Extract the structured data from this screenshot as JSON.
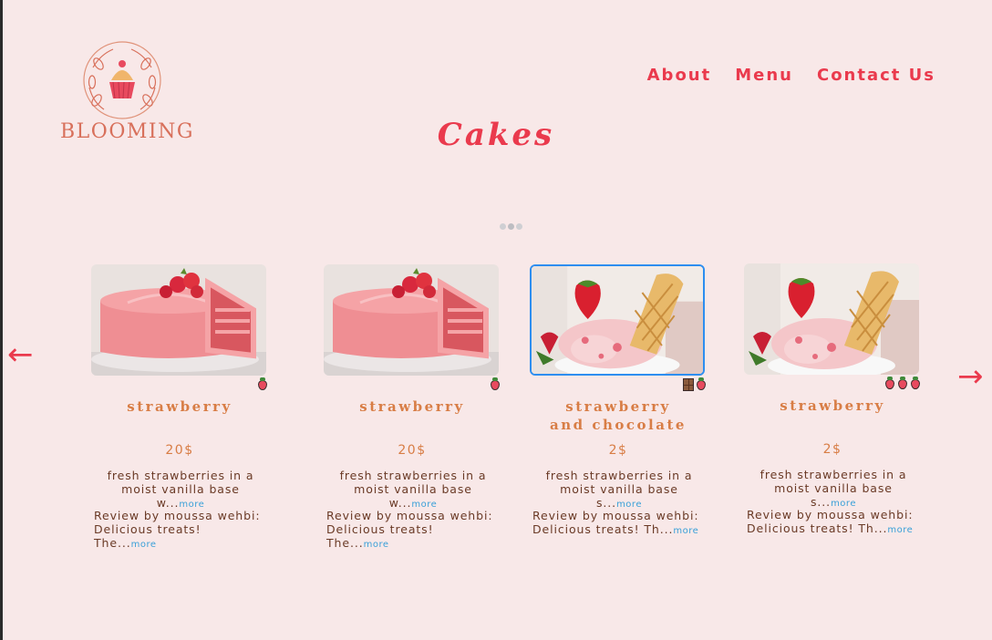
{
  "brand": {
    "name": "BLOOMING",
    "logo_icon": "cupcake-wreath-icon"
  },
  "nav": [
    {
      "label": "About"
    },
    {
      "label": "Menu"
    },
    {
      "label": "Contact Us"
    }
  ],
  "page": {
    "title": "Cakes"
  },
  "carousel": {
    "prev_icon": "arrow-left-icon",
    "next_icon": "arrow-right-icon",
    "prev_glyph": "←",
    "next_glyph": "→",
    "dots": 3,
    "active_dot": 1
  },
  "products": [
    {
      "name": "strawberry",
      "price": "20$",
      "desc_line1": "fresh strawberries in a",
      "desc_line2": "moist vanilla base w...",
      "review_line1": "Review by moussa wehbi:",
      "review_line2": "Delicious treats! The...",
      "more_label": "more",
      "image": "strawberry-cake",
      "badges": [
        "strawberry"
      ]
    },
    {
      "name": "strawberry",
      "price": "20$",
      "desc_line1": "fresh strawberries in a",
      "desc_line2": "moist vanilla base w...",
      "review_line1": "Review by moussa wehbi:",
      "review_line2": "Delicious treats! The...",
      "more_label": "more",
      "image": "strawberry-cake",
      "badges": [
        "strawberry"
      ]
    },
    {
      "name": "strawberry and chocolate",
      "name_line1": "strawberry",
      "name_line2": "and chocolate",
      "price": "2$",
      "desc_line1": "fresh strawberries in a",
      "desc_line2": "moist vanilla base s...",
      "review_line1": "Review by moussa wehbi:",
      "review_line2": "Delicious treats! Th...",
      "more_label": "more",
      "image": "strawberry-ice-cream",
      "selected": true,
      "badges": [
        "chocolate",
        "strawberry"
      ]
    },
    {
      "name": "strawberry",
      "price": "2$",
      "desc_line1": "fresh strawberries in a",
      "desc_line2": "moist vanilla base s...",
      "review_line1": "Review by moussa wehbi:",
      "review_line2": "Delicious treats! Th...",
      "more_label": "more",
      "image": "strawberry-ice-cream",
      "badges": [
        "strawberry",
        "strawberry",
        "strawberry"
      ]
    }
  ],
  "colors": {
    "background": "#f8e8e8",
    "accent": "#ea3a4d",
    "product_name": "#d87d45",
    "body_text": "#6a3a26",
    "link": "#3aa0d8",
    "selected_border": "#2d8ef0"
  }
}
